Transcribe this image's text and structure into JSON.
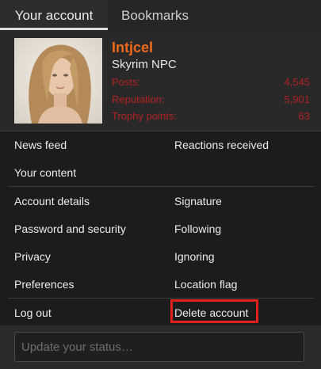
{
  "tabs": {
    "account": "Your account",
    "bookmarks": "Bookmarks"
  },
  "user": {
    "name": "Intjcel",
    "title": "Skyrim NPC",
    "stats": [
      {
        "label": "Posts:",
        "value": "4,545"
      },
      {
        "label": "Reputation:",
        "value": "5,901"
      },
      {
        "label": "Trophy points:",
        "value": "63"
      }
    ]
  },
  "links": {
    "news_feed": "News feed",
    "reactions_received": "Reactions received",
    "your_content": "Your content",
    "account_details": "Account details",
    "signature": "Signature",
    "password_security": "Password and security",
    "following": "Following",
    "privacy": "Privacy",
    "ignoring": "Ignoring",
    "preferences": "Preferences",
    "location_flag": "Location flag",
    "log_out": "Log out",
    "delete_account": "Delete account"
  },
  "status": {
    "placeholder": "Update your status…"
  },
  "colors": {
    "username": "#f26a1b",
    "stats": "#b22222",
    "highlight": "#e0211e"
  }
}
